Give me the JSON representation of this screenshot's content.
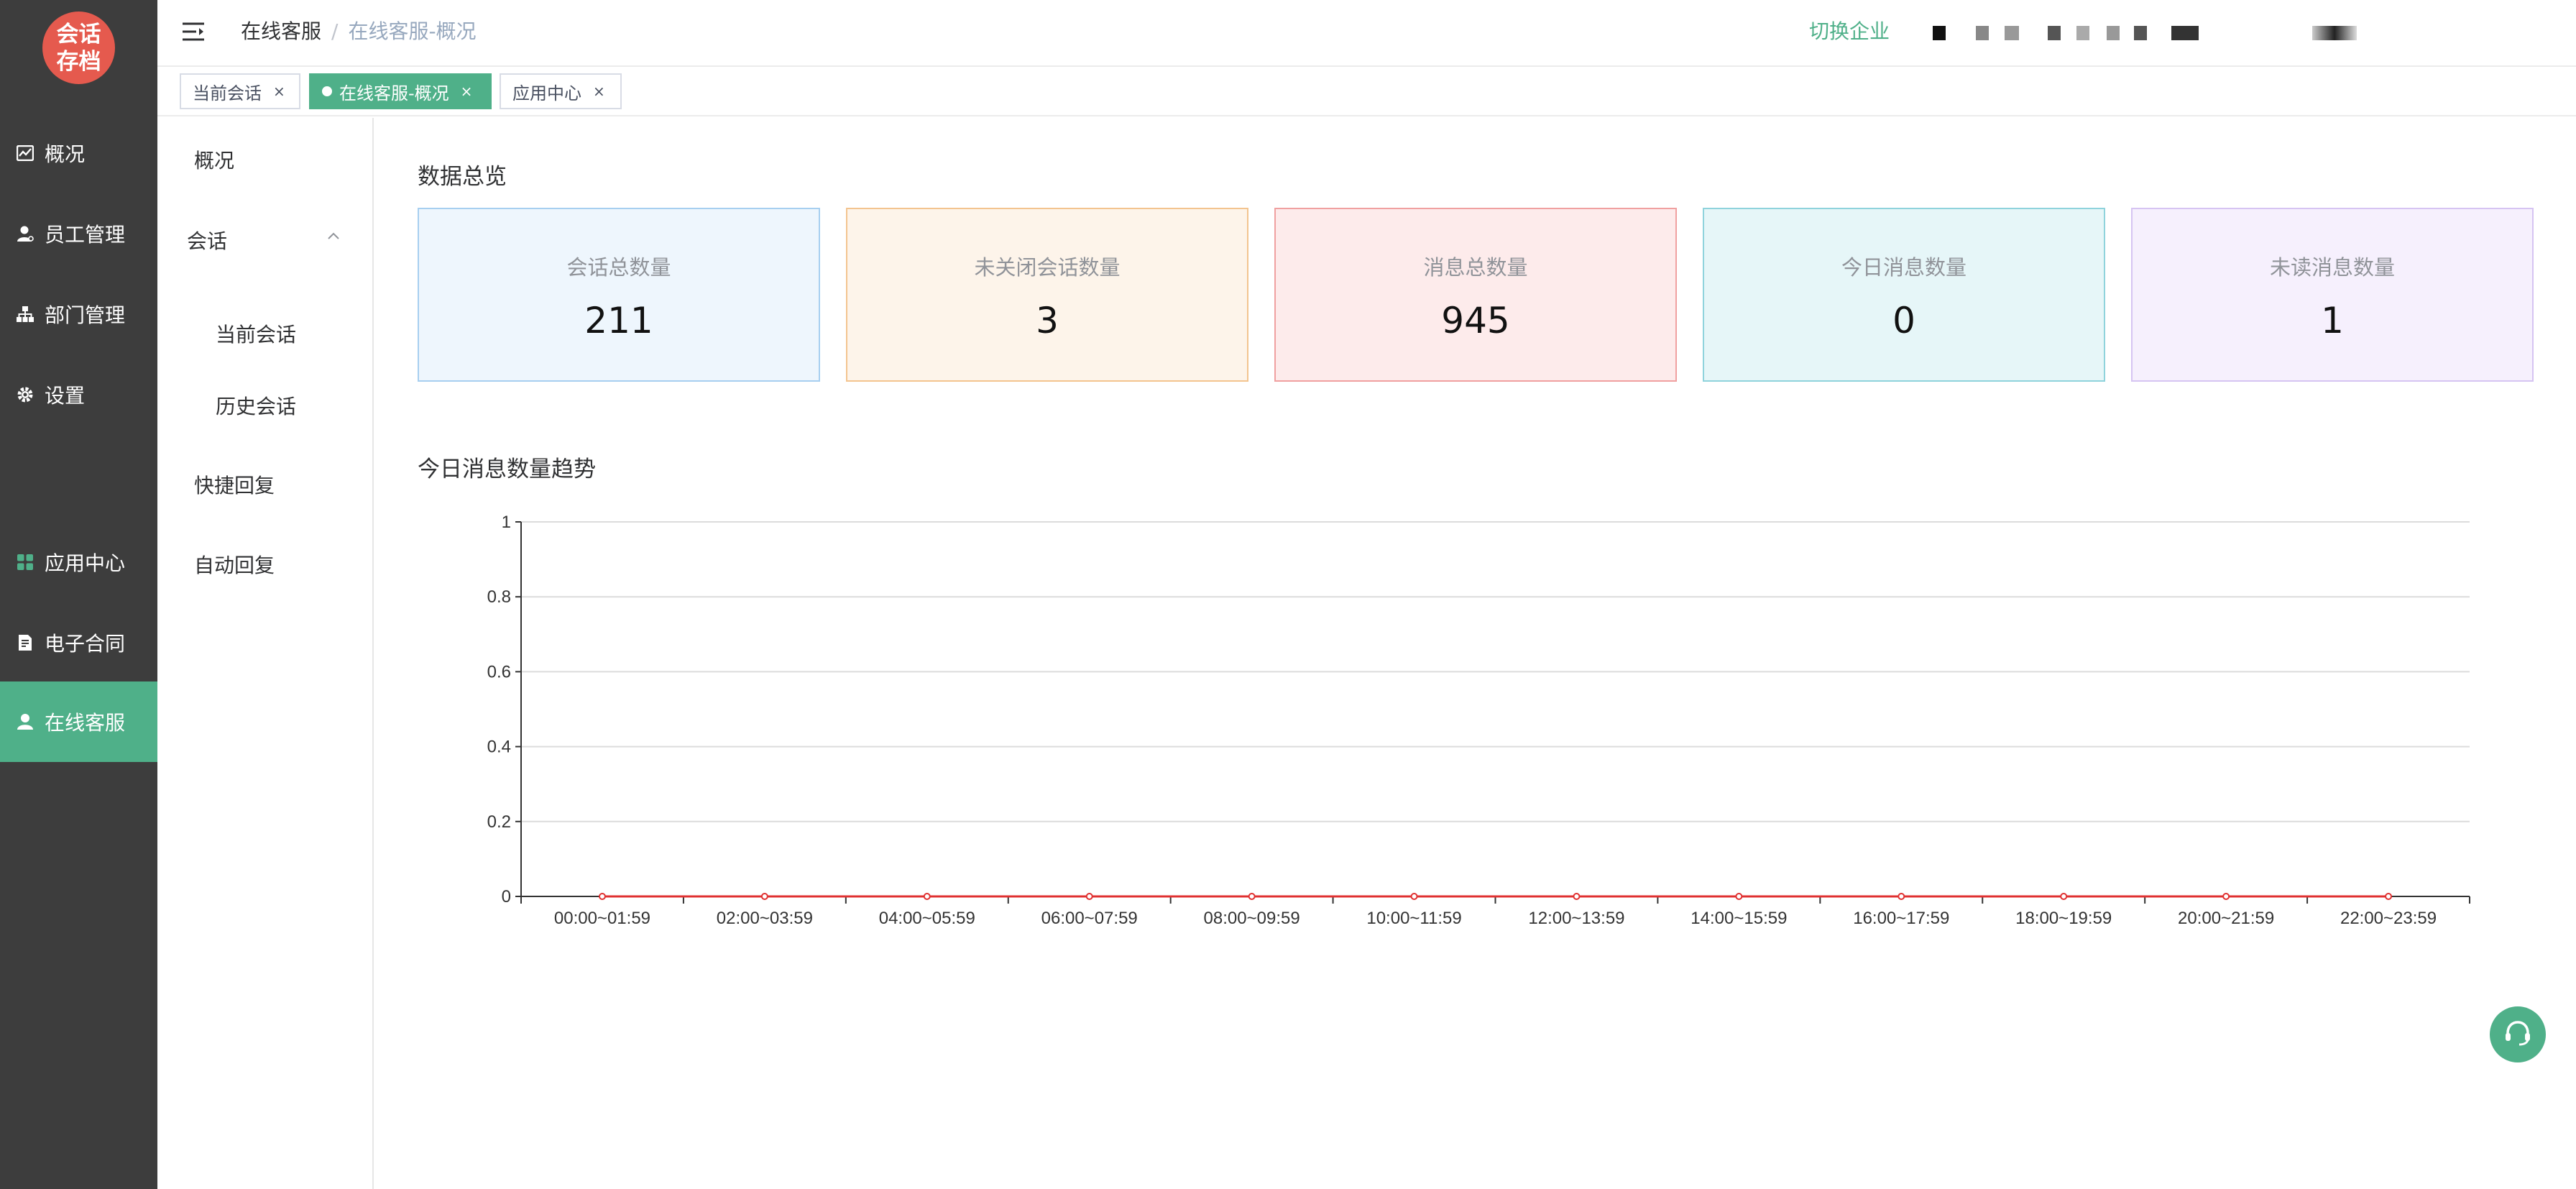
{
  "logo": {
    "line1": "会话",
    "line2": "存档"
  },
  "sidebar": {
    "items": [
      {
        "label": "概况",
        "icon": "chart-line-icon"
      },
      {
        "label": "员工管理",
        "icon": "user-icon"
      },
      {
        "label": "部门管理",
        "icon": "org-tree-icon"
      },
      {
        "label": "设置",
        "icon": "gear-icon"
      },
      {
        "label": "应用中心",
        "icon": "apps-grid-icon"
      },
      {
        "label": "电子合同",
        "icon": "document-icon"
      },
      {
        "label": "在线客服",
        "icon": "person-icon",
        "active": true
      }
    ]
  },
  "header": {
    "breadcrumb": {
      "root": "在线客服",
      "separator": "/",
      "current": "在线客服-概况"
    },
    "switch_enterprise": "切换企业"
  },
  "tabs": [
    {
      "label": "当前会话",
      "close": "×"
    },
    {
      "label": "在线客服-概况",
      "close": "×",
      "active": true
    },
    {
      "label": "应用中心",
      "close": "×"
    }
  ],
  "submenu": {
    "overview": "概况",
    "session": "会话",
    "current_session": "当前会话",
    "history_session": "历史会话",
    "quick_reply": "快捷回复",
    "auto_reply": "自动回复"
  },
  "overview": {
    "title": "数据总览",
    "cards": [
      {
        "label": "会话总数量",
        "value": "211",
        "bg": "#eef6fd",
        "border": "#a7cff0"
      },
      {
        "label": "未关闭会话数量",
        "value": "3",
        "bg": "#fdf4ea",
        "border": "#f3c48f"
      },
      {
        "label": "消息总数量",
        "value": "945",
        "bg": "#fdebeb",
        "border": "#f0a0a0"
      },
      {
        "label": "今日消息数量",
        "value": "0",
        "bg": "#e6f6f8",
        "border": "#8fd3dc"
      },
      {
        "label": "未读消息数量",
        "value": "1",
        "bg": "#f6f0fd",
        "border": "#d6c4f2"
      }
    ]
  },
  "trend": {
    "title": "今日消息数量趋势"
  },
  "chart_data": {
    "type": "line",
    "title": "",
    "xlabel": "",
    "ylabel": "",
    "categories": [
      "00:00~01:59",
      "02:00~03:59",
      "04:00~05:59",
      "06:00~07:59",
      "08:00~09:59",
      "10:00~11:59",
      "12:00~13:59",
      "14:00~15:59",
      "16:00~17:59",
      "18:00~19:59",
      "20:00~21:59",
      "22:00~23:59"
    ],
    "values": [
      0,
      0,
      0,
      0,
      0,
      0,
      0,
      0,
      0,
      0,
      0,
      0
    ],
    "ylim": [
      0,
      1
    ],
    "yticks": [
      "0",
      "0.2",
      "0.4",
      "0.6",
      "0.8",
      "1"
    ],
    "grid": true,
    "line_color": "#e03131"
  },
  "colors": {
    "accent": "#4fb089",
    "sidebar": "#3d3d3d",
    "logo": "#e55a4e"
  }
}
